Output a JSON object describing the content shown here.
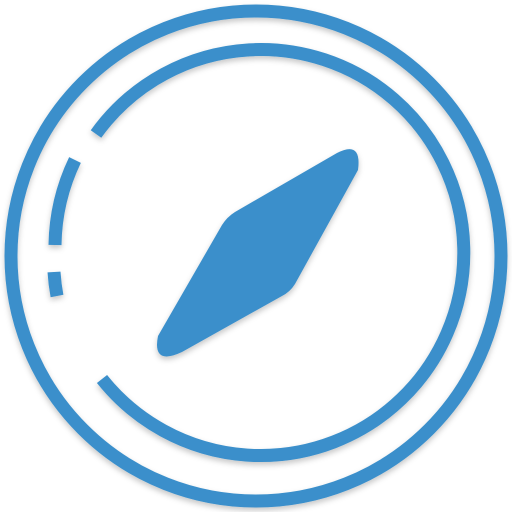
{
  "icon": {
    "name": "compass-icon",
    "colors": {
      "primary": "#3a8fcb",
      "background": "#ffffff"
    }
  }
}
